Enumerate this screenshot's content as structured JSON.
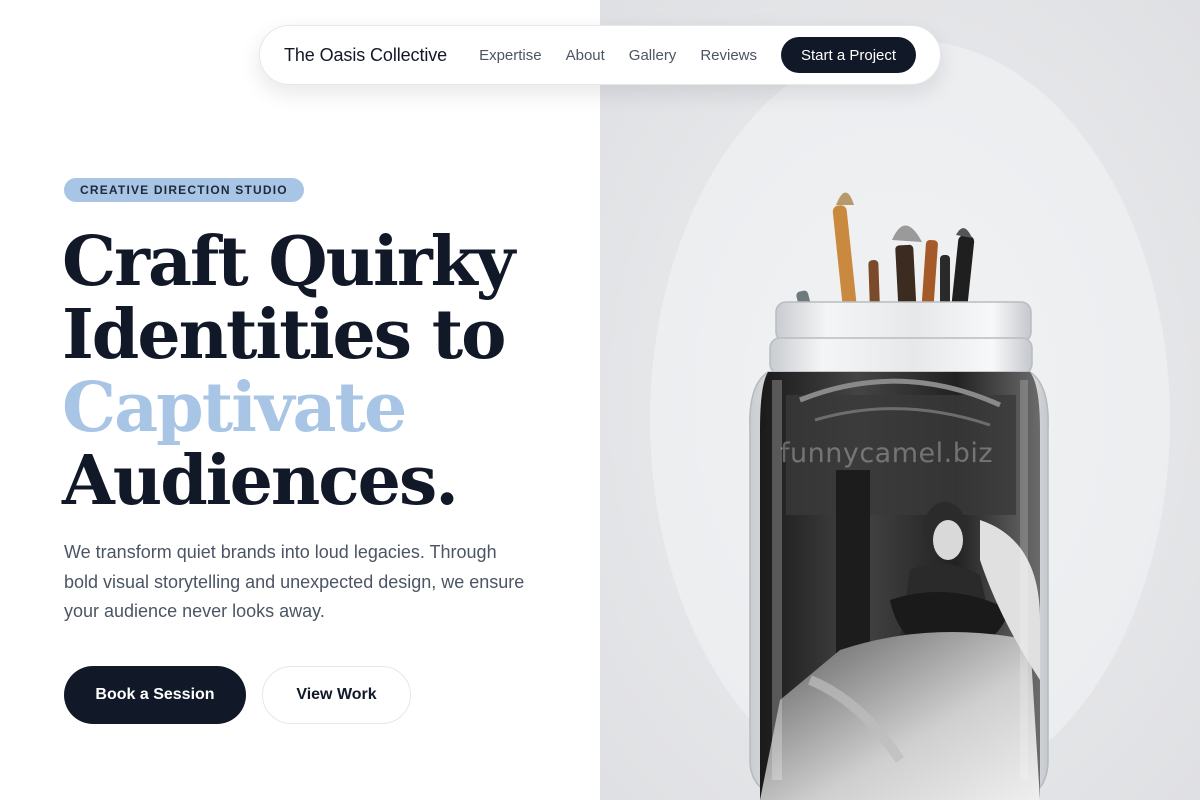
{
  "nav": {
    "brand": "The Oasis Collective",
    "links": [
      "Expertise",
      "About",
      "Gallery",
      "Reviews"
    ],
    "cta": "Start a Project"
  },
  "hero": {
    "badge": "CREATIVE DIRECTION STUDIO",
    "headline": {
      "line1": "Craft Quirky",
      "line2": "Identities to",
      "accent": "Captivate",
      "line4": "Audiences."
    },
    "subtitle": "We transform quiet brands into loud legacies. Through bold visual storytelling and unexpected design, we ensure your audience never looks away.",
    "primary_button": "Book a Session",
    "secondary_button": "View Work"
  },
  "image": {
    "watermark": "funnycamel.biz"
  },
  "colors": {
    "navy": "#111827",
    "accent": "#a8c5e6",
    "body_text": "#4b5563"
  }
}
